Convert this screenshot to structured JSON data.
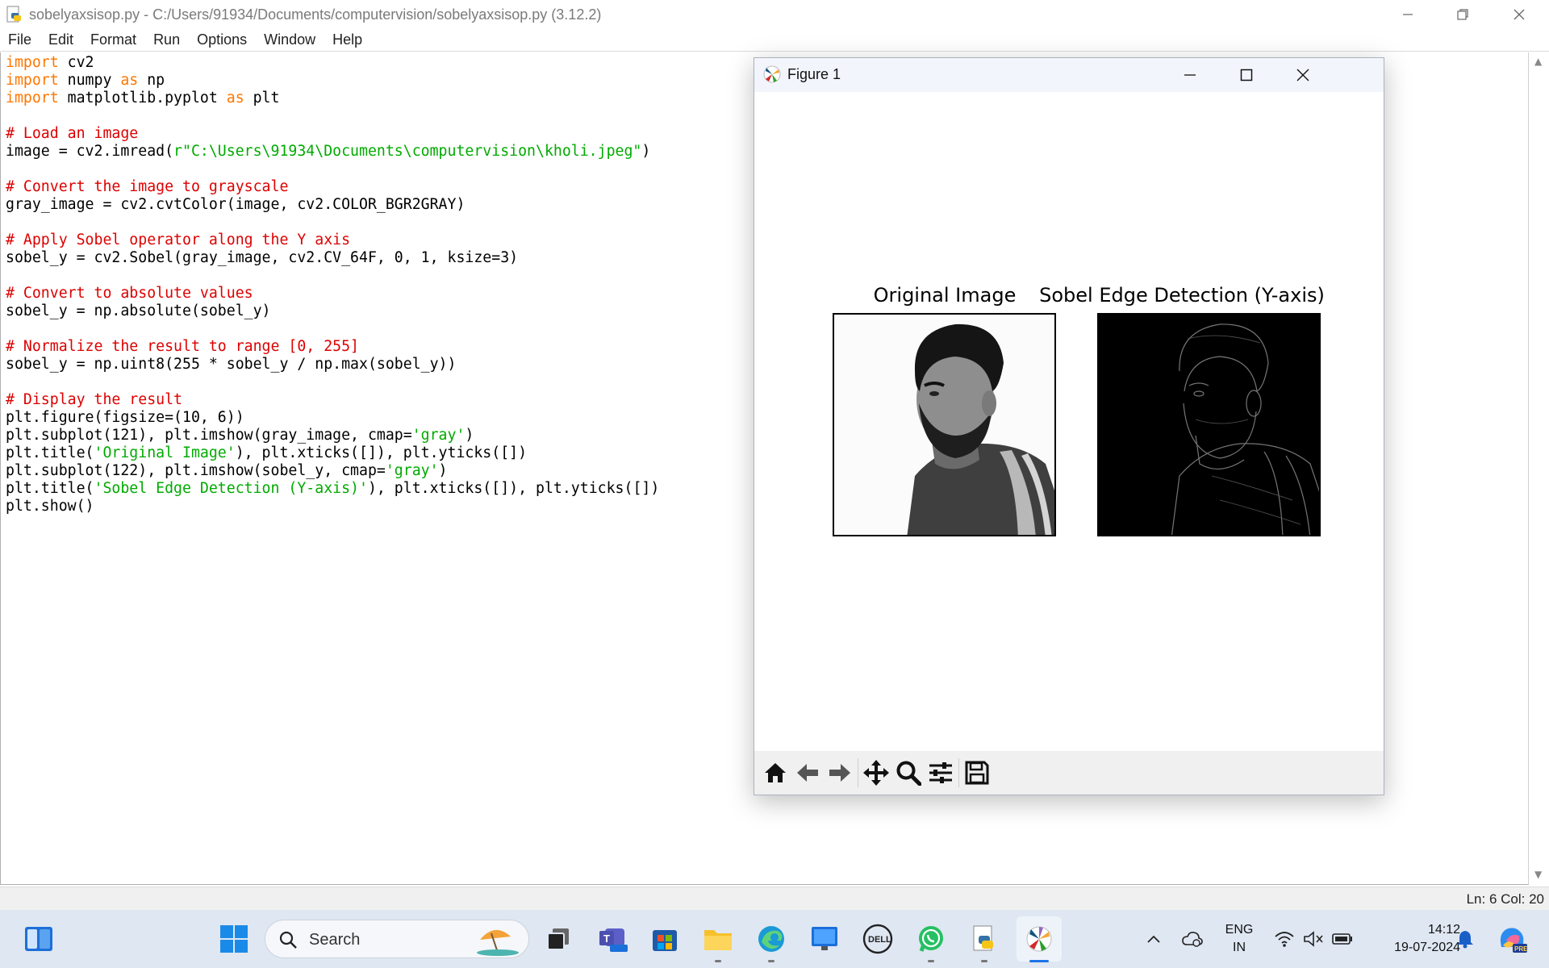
{
  "window": {
    "title": "sobelyaxsisop.py - C:/Users/91934/Documents/computervision/sobelyaxsisop.py (3.12.2)"
  },
  "menu": [
    "File",
    "Edit",
    "Format",
    "Run",
    "Options",
    "Window",
    "Help"
  ],
  "code_lines": [
    [
      {
        "t": "import",
        "c": "kw"
      },
      {
        "t": " cv2",
        "c": ""
      }
    ],
    [
      {
        "t": "import",
        "c": "kw"
      },
      {
        "t": " numpy ",
        "c": ""
      },
      {
        "t": "as",
        "c": "kw"
      },
      {
        "t": " np",
        "c": ""
      }
    ],
    [
      {
        "t": "import",
        "c": "kw"
      },
      {
        "t": " matplotlib.pyplot ",
        "c": ""
      },
      {
        "t": "as",
        "c": "kw"
      },
      {
        "t": " plt",
        "c": ""
      }
    ],
    [],
    [
      {
        "t": "# Load an image",
        "c": "cm"
      }
    ],
    [
      {
        "t": "image = cv2.imread(",
        "c": ""
      },
      {
        "t": "r\"C:\\Users\\91934\\Documents\\computervision\\kholi.jpeg\"",
        "c": "st"
      },
      {
        "t": ")",
        "c": ""
      }
    ],
    [],
    [
      {
        "t": "# Convert the image to grayscale",
        "c": "cm"
      }
    ],
    [
      {
        "t": "gray_image = cv2.cvtColor(image, cv2.COLOR_BGR2GRAY)",
        "c": ""
      }
    ],
    [],
    [
      {
        "t": "# Apply Sobel operator along the Y axis",
        "c": "cm"
      }
    ],
    [
      {
        "t": "sobel_y = cv2.Sobel(gray_image, cv2.CV_64F, 0, 1, ksize=3)",
        "c": ""
      }
    ],
    [],
    [
      {
        "t": "# Convert to absolute values",
        "c": "cm"
      }
    ],
    [
      {
        "t": "sobel_y = np.absolute(sobel_y)",
        "c": ""
      }
    ],
    [],
    [
      {
        "t": "# Normalize the result to range [0, 255]",
        "c": "cm"
      }
    ],
    [
      {
        "t": "sobel_y = np.uint8(255 * sobel_y / np.max(sobel_y))",
        "c": ""
      }
    ],
    [],
    [
      {
        "t": "# Display the result",
        "c": "cm"
      }
    ],
    [
      {
        "t": "plt.figure(figsize=(10, 6))",
        "c": ""
      }
    ],
    [
      {
        "t": "plt.subplot(121), plt.imshow(gray_image, cmap=",
        "c": ""
      },
      {
        "t": "'gray'",
        "c": "st"
      },
      {
        "t": ")",
        "c": ""
      }
    ],
    [
      {
        "t": "plt.title(",
        "c": ""
      },
      {
        "t": "'Original Image'",
        "c": "st"
      },
      {
        "t": "), plt.xticks([]), plt.yticks([])",
        "c": ""
      }
    ],
    [
      {
        "t": "plt.subplot(122), plt.imshow(sobel_y, cmap=",
        "c": ""
      },
      {
        "t": "'gray'",
        "c": "st"
      },
      {
        "t": ")",
        "c": ""
      }
    ],
    [
      {
        "t": "plt.title(",
        "c": ""
      },
      {
        "t": "'Sobel Edge Detection (Y-axis)'",
        "c": "st"
      },
      {
        "t": "), plt.xticks([]), plt.yticks([])",
        "c": ""
      }
    ],
    [
      {
        "t": "plt.show()",
        "c": ""
      }
    ]
  ],
  "status": {
    "position": "Ln: 6   Col: 20"
  },
  "figure": {
    "title": "Figure 1",
    "subplots": [
      {
        "title": "Original Image"
      },
      {
        "title": "Sobel Edge Detection (Y-axis)"
      }
    ],
    "toolbar": [
      "home-icon",
      "back-arrow-icon",
      "forward-arrow-icon",
      "pan-icon",
      "zoom-icon",
      "configure-subplots-icon",
      "save-icon"
    ]
  },
  "taskbar": {
    "search_placeholder": "Search",
    "language": "ENG",
    "region": "IN",
    "time": "14:12",
    "date": "19-07-2024"
  }
}
